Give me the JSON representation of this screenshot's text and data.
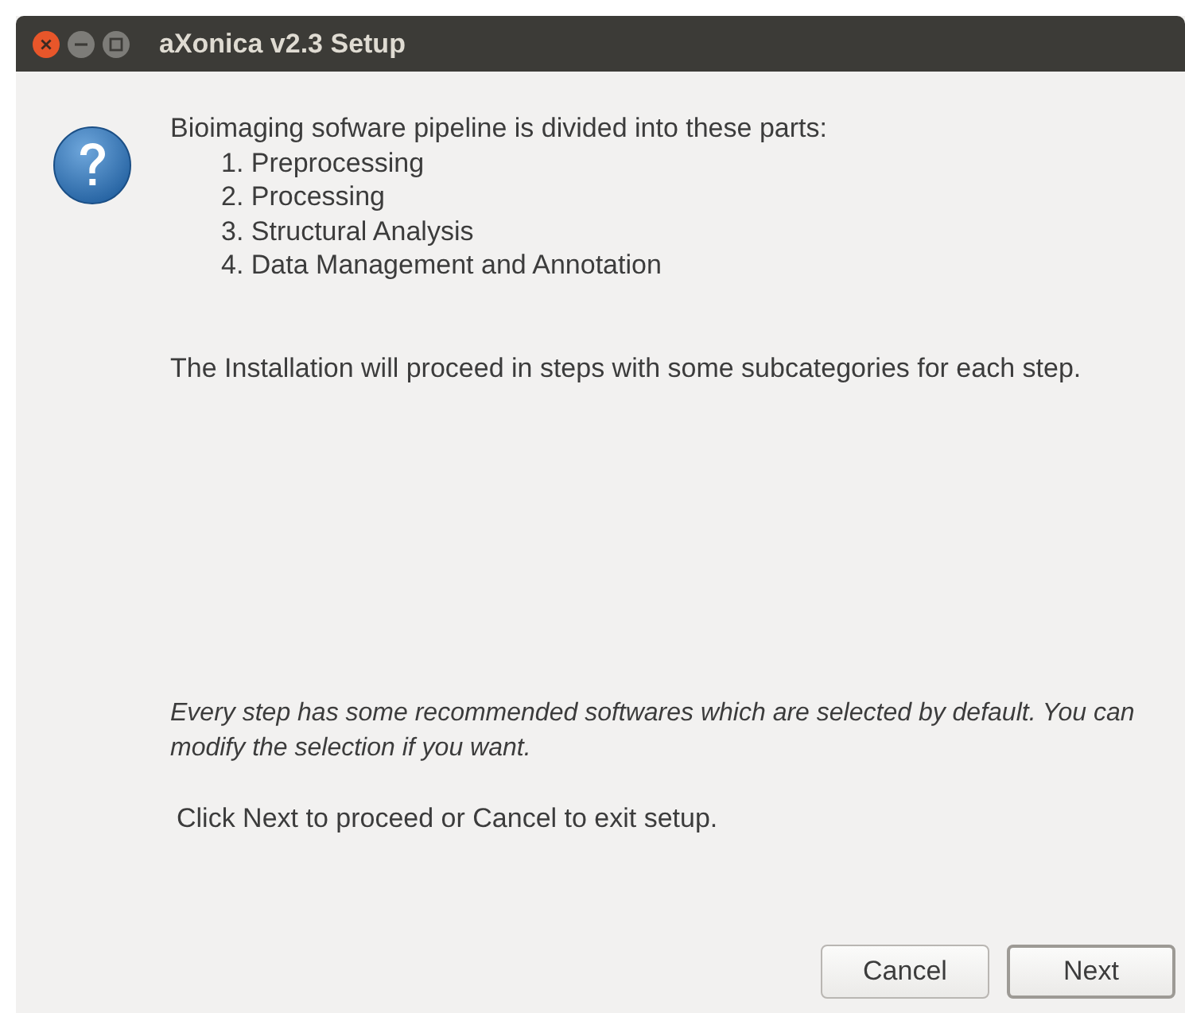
{
  "window": {
    "title": "aXonica v2.3 Setup"
  },
  "intro": "Bioimaging sofware pipeline is divided into these parts:",
  "parts": [
    "1. Preprocessing",
    "2. Processing",
    "3. Structural Analysis",
    "4. Data Management and Annotation"
  ],
  "steps_note": "The Installation will proceed in steps with some subcategories for each step.",
  "recommendation_note": "Every step has some recommended softwares which are selected by default. You can modify the selection if you want.",
  "instruction": "Click Next to proceed or Cancel to exit setup.",
  "buttons": [
    {
      "label": "Cancel",
      "default": false
    },
    {
      "label": "Next",
      "default": true
    }
  ]
}
